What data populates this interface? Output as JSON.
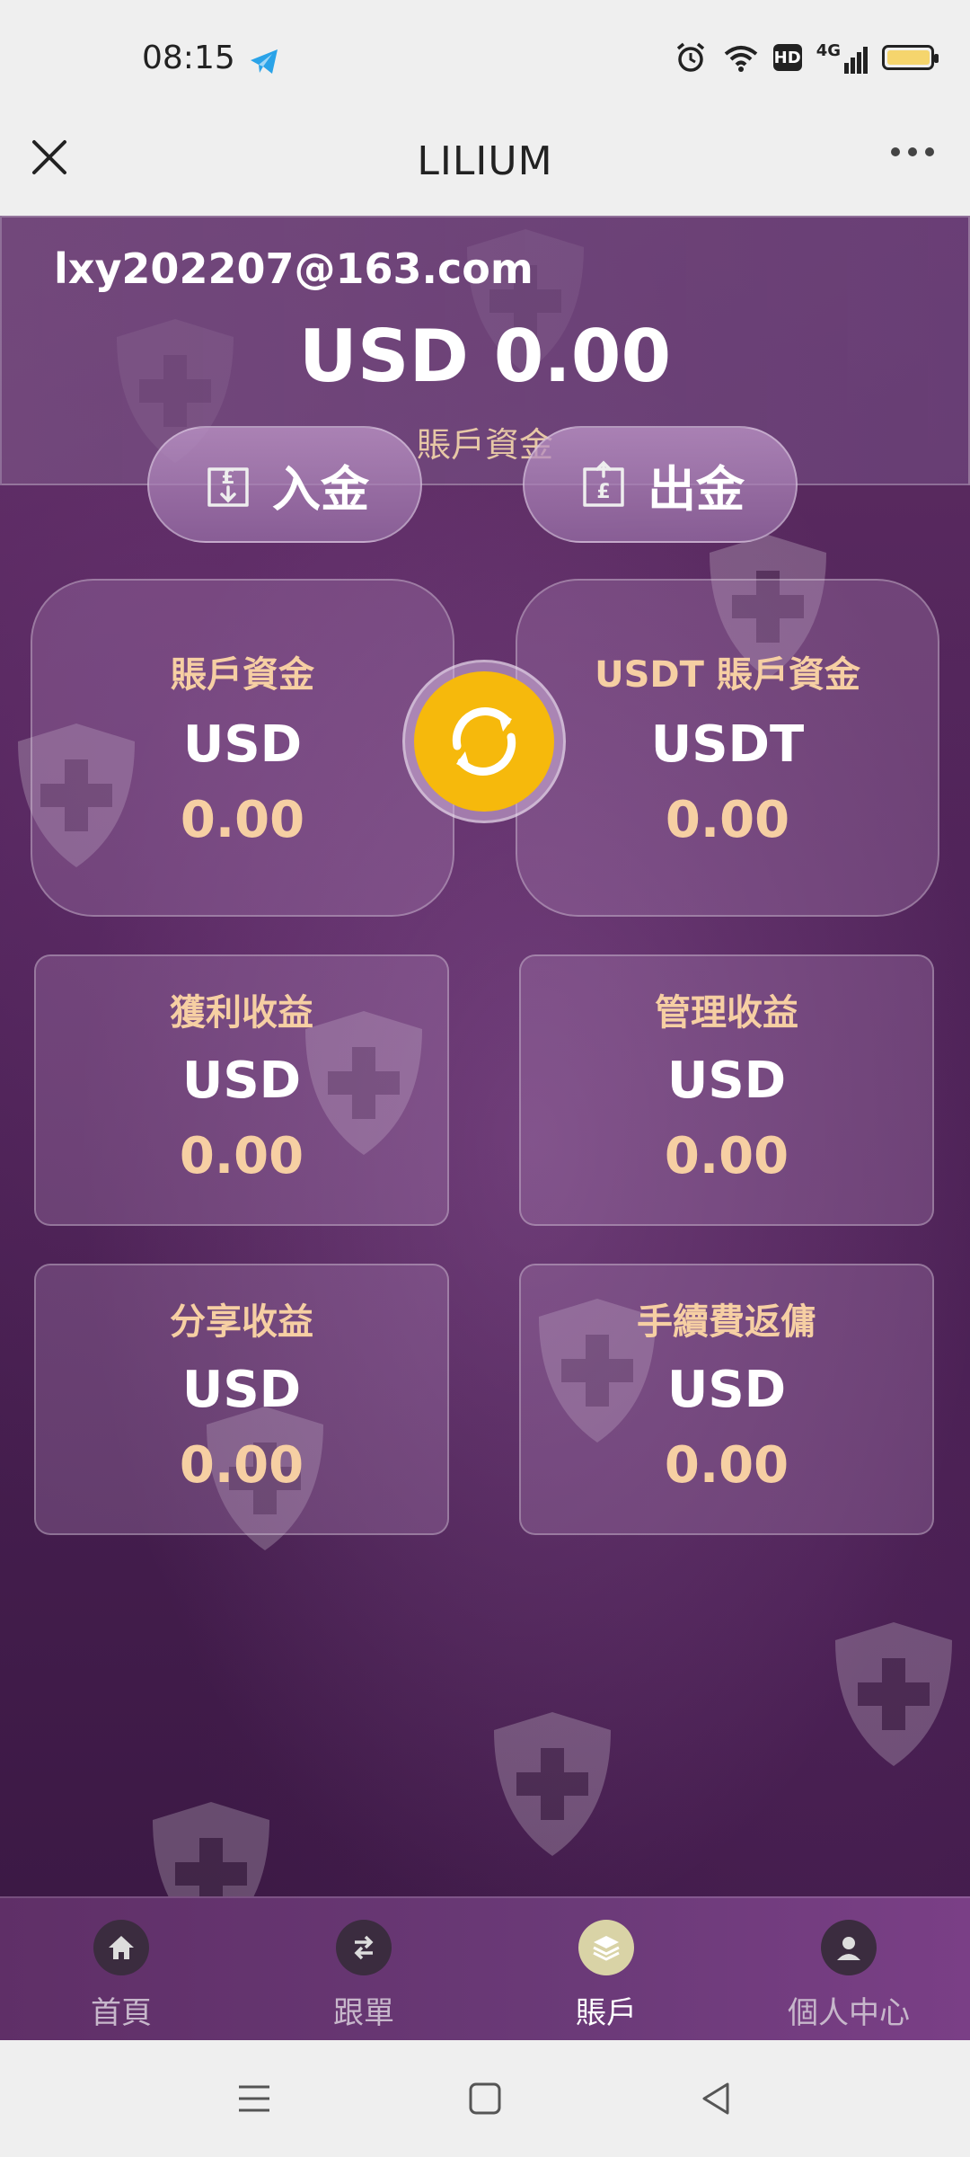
{
  "status_bar": {
    "time": "08:15",
    "hd": "HD",
    "network": "4G",
    "icons": [
      "telegram-icon",
      "alarm-icon",
      "wifi-icon",
      "hd-icon",
      "signal-icon",
      "battery-icon"
    ],
    "battery_level": 0.9
  },
  "header": {
    "title": "LILIUM",
    "close_icon": "close-icon",
    "more_icon": "more-icon"
  },
  "account": {
    "email": "lxy202207@163.com",
    "balance": "USD 0.00",
    "balance_label": "賬戶資金"
  },
  "actions": {
    "deposit_label": "入金",
    "withdraw_label": "出金"
  },
  "cards": [
    {
      "title": "賬戶資金",
      "currency": "USD",
      "value": "0.00"
    },
    {
      "title": "USDT 賬戶資金",
      "currency": "USDT",
      "value": "0.00"
    },
    {
      "title": "獲利收益",
      "currency": "USD",
      "value": "0.00"
    },
    {
      "title": "管理收益",
      "currency": "USD",
      "value": "0.00"
    },
    {
      "title": "分享收益",
      "currency": "USD",
      "value": "0.00"
    },
    {
      "title": "手續費返傭",
      "currency": "USD",
      "value": "0.00"
    }
  ],
  "bottom_nav": [
    {
      "label": "首頁",
      "icon": "home-icon",
      "active": false
    },
    {
      "label": "跟單",
      "icon": "swap-icon",
      "active": false
    },
    {
      "label": "賬戶",
      "icon": "layers-icon",
      "active": true
    },
    {
      "label": "個人中心",
      "icon": "user-icon",
      "active": false
    }
  ],
  "colors": {
    "accent_gold": "#f6cfa3",
    "swap_yellow": "#f6b90c",
    "background_purple": "#4f2358"
  }
}
